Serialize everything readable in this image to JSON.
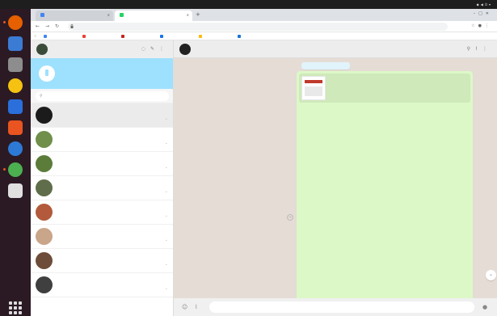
{
  "system": {
    "activities": "",
    "app_menu": "",
    "clock": "",
    "tray": ""
  },
  "dock": {
    "apps": [
      {
        "icon": "firefox-icon",
        "color": "#e66000"
      },
      {
        "icon": "thunderbird-icon",
        "color": "#3b7bd4"
      },
      {
        "icon": "files-icon",
        "color": "#8d8d8d"
      },
      {
        "icon": "rhythmbox-icon",
        "color": "#f5c211"
      },
      {
        "icon": "libreoffice-writer-icon",
        "color": "#2a6fdb"
      },
      {
        "icon": "software-center-icon",
        "color": "#e95420"
      },
      {
        "icon": "help-icon",
        "color": "#2c7ad6"
      },
      {
        "icon": "chrome-icon",
        "color": "#4caf50"
      },
      {
        "icon": "text-editor-icon",
        "color": "#e0e0e0"
      }
    ],
    "apps_grid_icon": "grid-icon"
  },
  "browser": {
    "tabs": [
      {
        "title": "",
        "favicon_color": "#4285f4",
        "active": false
      },
      {
        "title": "",
        "favicon_color": "#25d366",
        "active": true
      }
    ],
    "url": "",
    "bookmarks": [
      {
        "label": "",
        "color": "#4285f4"
      },
      {
        "label": "",
        "color": "#ea4335"
      },
      {
        "label": "",
        "color": "#c5221f"
      },
      {
        "label": "",
        "color": "#1a73e8"
      },
      {
        "label": "",
        "color": "#fbbc04"
      },
      {
        "label": "",
        "color": "#1976d2"
      }
    ]
  },
  "whatsapp": {
    "notification": {
      "title": "",
      "subtitle": ""
    },
    "search_placeholder": "",
    "chats": [
      {
        "name": "",
        "preview": "",
        "time": "",
        "avatar_color": "#1b1b1b",
        "active": true
      },
      {
        "name": "",
        "preview": "",
        "time": "",
        "avatar_color": "#6f8f4a",
        "active": false
      },
      {
        "name": "",
        "preview": "",
        "time": "",
        "avatar_color": "#5c7c3a",
        "active": false
      },
      {
        "name": "",
        "preview": "",
        "time": "",
        "avatar_color": "#5f6d4a",
        "active": false
      },
      {
        "name": "",
        "preview": "",
        "time": "",
        "avatar_color": "#b25a3b",
        "active": false
      },
      {
        "name": "",
        "preview": "",
        "time": "",
        "avatar_color": "#c9a58a",
        "active": false
      },
      {
        "name": "",
        "preview": "",
        "time": "",
        "avatar_color": "#6d4d3a",
        "active": false
      },
      {
        "name": "",
        "preview": "",
        "time": "",
        "avatar_color": "#3f3f3f",
        "active": false
      }
    ],
    "conversation": {
      "title": "",
      "members": "",
      "date_label": "",
      "link_preview": {
        "title": "",
        "description": "",
        "url": ""
      },
      "lines": [
        {
          "text": "",
          "link": false
        },
        {
          "text": "",
          "link": false
        },
        {
          "text": "",
          "link": true
        },
        {
          "text": "",
          "link": false
        },
        {
          "text": "",
          "link": false
        },
        {
          "text": "",
          "link": false
        },
        {
          "text": "",
          "link": false
        },
        {
          "text": "",
          "link": false
        },
        {
          "text": "",
          "link": false
        },
        {
          "text": "",
          "link": false
        },
        {
          "text": "",
          "link": false
        },
        {
          "text": "",
          "link": false
        },
        {
          "text": "",
          "link": false
        },
        {
          "text": "",
          "link": false
        },
        {
          "text": "",
          "link": false
        },
        {
          "text": "",
          "link": false
        },
        {
          "text": "",
          "link": false
        },
        {
          "text": "",
          "link": true
        },
        {
          "text": "",
          "link": false
        },
        {
          "text": "",
          "link": false
        },
        {
          "text": "",
          "link": false
        },
        {
          "text": "",
          "link": false
        },
        {
          "text": "",
          "link": false
        },
        {
          "text": "",
          "link": false
        },
        {
          "text": "",
          "link": false
        },
        {
          "text": "",
          "link": false
        },
        {
          "text": "",
          "link": false
        },
        {
          "text": "",
          "link": false
        },
        {
          "text": "",
          "link": false
        },
        {
          "text": "",
          "link": false
        },
        {
          "text": "",
          "link": false
        },
        {
          "text": "",
          "link": false
        },
        {
          "text": "",
          "link": false
        },
        {
          "text": "",
          "link": false
        },
        {
          "text": "",
          "link": false
        }
      ]
    },
    "composer_placeholder": ""
  },
  "colors": {
    "notification_bg": "#9de1fe",
    "bubble_bg": "#dcf8c6",
    "chat_bg": "#e5ddd5",
    "link": "#039be5"
  }
}
